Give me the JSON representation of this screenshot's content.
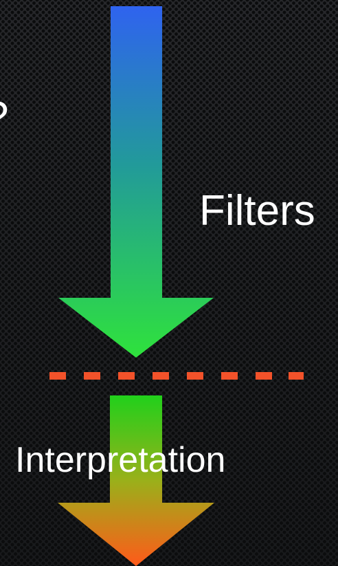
{
  "slide": {
    "partial_text": "?",
    "filters_label": "Filters",
    "interpretation_label": "Interpretation"
  },
  "colors": {
    "arrow_top_start": "#2f63ef",
    "arrow_top_end": "#2fe23c",
    "arrow_bottom_start": "#21d01b",
    "arrow_bottom_end": "#ff5a1a",
    "divider": "#f2522a",
    "text": "#ffffff"
  }
}
